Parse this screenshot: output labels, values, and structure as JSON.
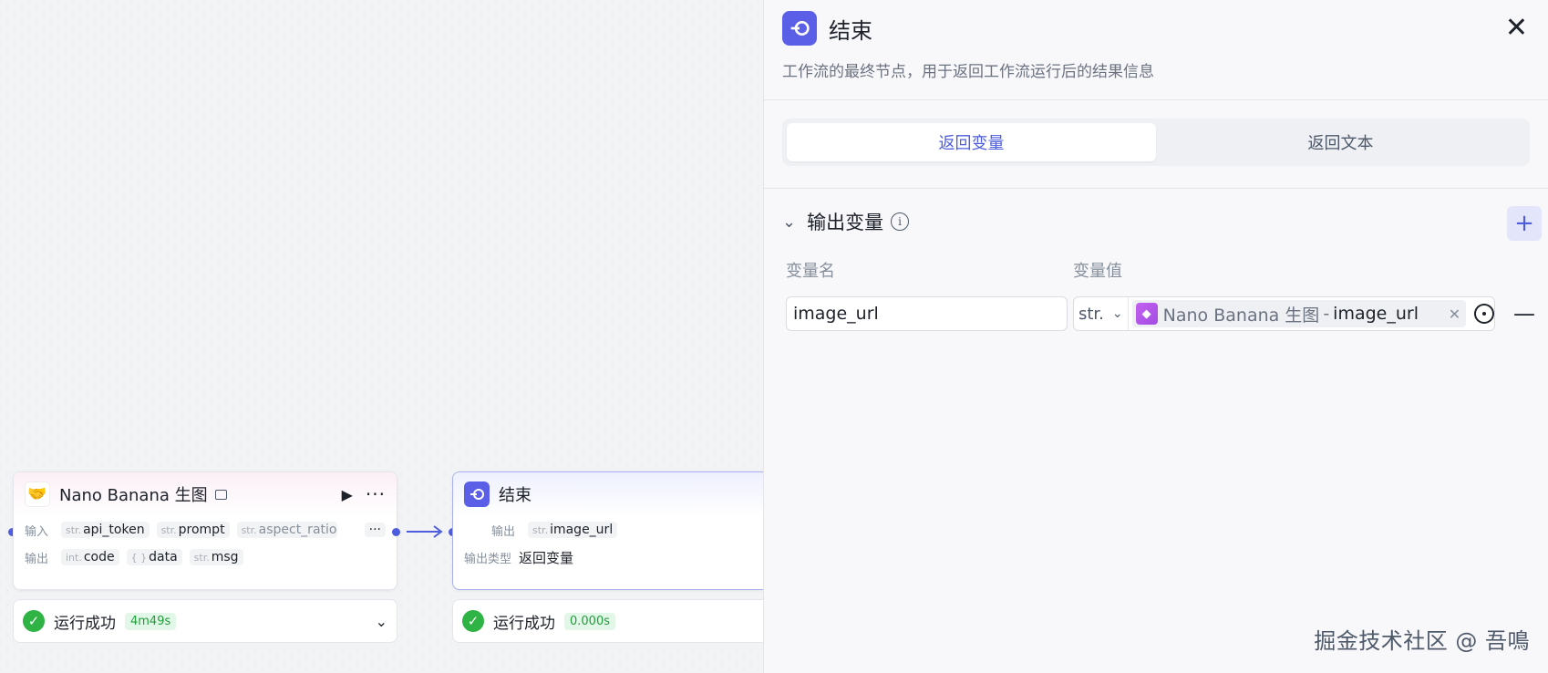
{
  "canvas": {
    "source_node": {
      "title": "Nano Banana 生图",
      "input_label": "输入",
      "output_label": "输出",
      "inputs": [
        {
          "type": "str.",
          "name": "api_token"
        },
        {
          "type": "str.",
          "name": "prompt"
        },
        {
          "type": "str.",
          "name": "aspect_ratio"
        }
      ],
      "outputs": [
        {
          "type": "int.",
          "name": "code"
        },
        {
          "type": "{ }",
          "name": "data"
        },
        {
          "type": "str.",
          "name": "msg"
        }
      ],
      "status": "运行成功",
      "duration": "4m49s"
    },
    "end_node": {
      "title": "结束",
      "output_label": "输出",
      "output_type_label": "输出类型",
      "output": {
        "type": "str.",
        "name": "image_url"
      },
      "output_type": "返回变量",
      "status": "运行成功",
      "duration": "0.000s"
    }
  },
  "panel": {
    "title": "结束",
    "description": "工作流的最终节点，用于返回工作流运行后的结果信息",
    "tabs": [
      "返回变量",
      "返回文本"
    ],
    "active_tab": 0,
    "section_title": "输出变量",
    "column_name": "变量名",
    "column_value": "变量值",
    "variable": {
      "name": "image_url",
      "type": "str.",
      "ref_node": "Nano Banana 生图",
      "ref_sep": "-",
      "ref_var": "image_url"
    }
  },
  "watermark": "掘金技术社区 @ 吾鳴",
  "colors": {
    "accent": "#4e5dde",
    "success": "#2fb344",
    "end_icon": "#5b5fe8"
  }
}
